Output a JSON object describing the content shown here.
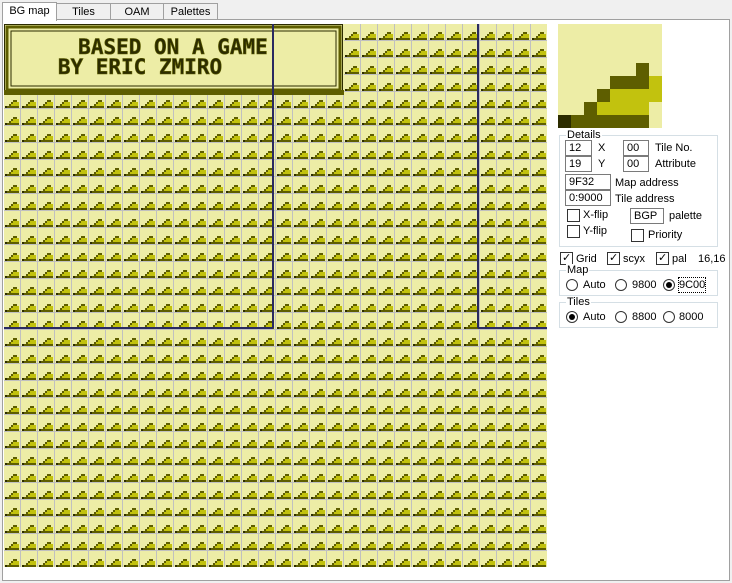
{
  "tabs": [
    "BG map",
    "Tiles",
    "OAM",
    "Palettes"
  ],
  "map_title": {
    "line1": "BASED ON A GAME",
    "line2": "BY ERIC ZMIRO"
  },
  "details": {
    "label": "Details",
    "x": "12",
    "x_label": "X",
    "y": "19",
    "y_label": "Y",
    "tile_no": "00",
    "tile_no_label": "Tile No.",
    "attribute": "00",
    "attribute_label": "Attribute",
    "map_address": "9F32",
    "map_address_label": "Map address",
    "tile_address": "0:9000",
    "tile_address_label": "Tile address",
    "xflip_label": "X-flip",
    "yflip_label": "Y-flip",
    "palette": "BGP",
    "palette_label": "palette",
    "priority_label": "Priority"
  },
  "options": {
    "grid_label": "Grid",
    "scyx_label": "scyx",
    "pal_label": "pal",
    "coords": "16,16"
  },
  "map_group": {
    "label": "Map",
    "options": [
      "Auto",
      "9800",
      "9C00"
    ],
    "selected": 2
  },
  "tiles_group": {
    "label": "Tiles",
    "options": [
      "Auto",
      "8800",
      "8000"
    ],
    "selected": 0
  },
  "colors": {
    "light": "#ededa6",
    "mid": "#c2c20e",
    "dark": "#5e5e00",
    "darkest": "#2c2c00",
    "grid": "#c0c0c0",
    "window": "#2a2a60"
  }
}
